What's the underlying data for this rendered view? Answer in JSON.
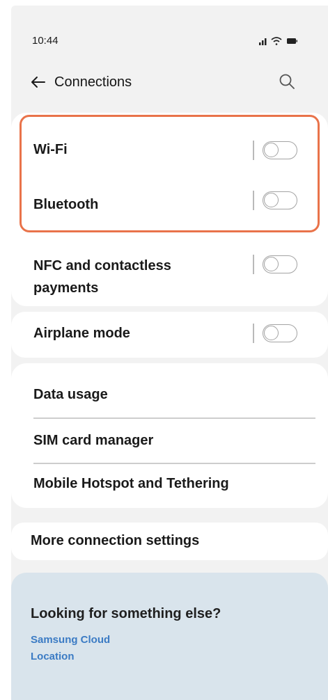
{
  "status_bar": {
    "time": "10:44",
    "icons": [
      "signal-icon",
      "wifi-icon",
      "battery-icon"
    ]
  },
  "header": {
    "title": "Connections",
    "back_icon": "arrow-left-icon",
    "search_icon": "search-icon"
  },
  "group1": {
    "items": [
      {
        "label": "Wi-Fi",
        "toggle": "off"
      },
      {
        "label": "Bluetooth",
        "toggle": "off"
      },
      {
        "label_line1": "NFC and contactless",
        "label_line2": "payments",
        "toggle": "off"
      }
    ]
  },
  "group2": {
    "items": [
      {
        "label": "Airplane mode",
        "toggle": "off"
      }
    ]
  },
  "group3": {
    "items": [
      {
        "label": "Data usage"
      },
      {
        "label": "SIM card manager"
      },
      {
        "label": "Mobile Hotspot and Tethering"
      }
    ]
  },
  "group4": {
    "items": [
      {
        "label": "More connection settings"
      }
    ]
  },
  "looking": {
    "title": "Looking for something else?",
    "links": [
      "Samsung Cloud",
      "Location"
    ]
  },
  "colors": {
    "highlight": "#e9734a",
    "link": "#3b7bc4",
    "panel": "#d9e4ec",
    "background": "#f2f2f2"
  }
}
